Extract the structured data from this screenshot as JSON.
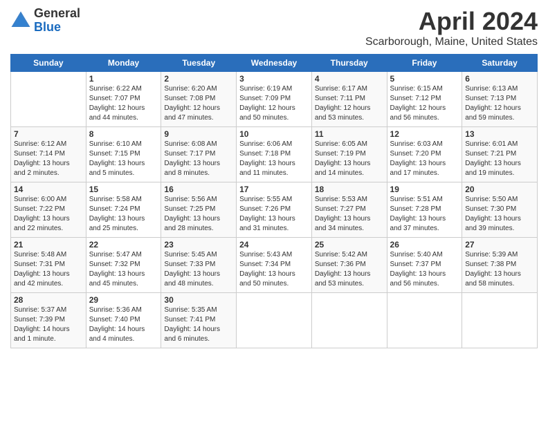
{
  "header": {
    "logo_general": "General",
    "logo_blue": "Blue",
    "month": "April 2024",
    "location": "Scarborough, Maine, United States"
  },
  "weekdays": [
    "Sunday",
    "Monday",
    "Tuesday",
    "Wednesday",
    "Thursday",
    "Friday",
    "Saturday"
  ],
  "weeks": [
    [
      {
        "day": "",
        "sunrise": "",
        "sunset": "",
        "daylight": ""
      },
      {
        "day": "1",
        "sunrise": "Sunrise: 6:22 AM",
        "sunset": "Sunset: 7:07 PM",
        "daylight": "Daylight: 12 hours and 44 minutes."
      },
      {
        "day": "2",
        "sunrise": "Sunrise: 6:20 AM",
        "sunset": "Sunset: 7:08 PM",
        "daylight": "Daylight: 12 hours and 47 minutes."
      },
      {
        "day": "3",
        "sunrise": "Sunrise: 6:19 AM",
        "sunset": "Sunset: 7:09 PM",
        "daylight": "Daylight: 12 hours and 50 minutes."
      },
      {
        "day": "4",
        "sunrise": "Sunrise: 6:17 AM",
        "sunset": "Sunset: 7:11 PM",
        "daylight": "Daylight: 12 hours and 53 minutes."
      },
      {
        "day": "5",
        "sunrise": "Sunrise: 6:15 AM",
        "sunset": "Sunset: 7:12 PM",
        "daylight": "Daylight: 12 hours and 56 minutes."
      },
      {
        "day": "6",
        "sunrise": "Sunrise: 6:13 AM",
        "sunset": "Sunset: 7:13 PM",
        "daylight": "Daylight: 12 hours and 59 minutes."
      }
    ],
    [
      {
        "day": "7",
        "sunrise": "Sunrise: 6:12 AM",
        "sunset": "Sunset: 7:14 PM",
        "daylight": "Daylight: 13 hours and 2 minutes."
      },
      {
        "day": "8",
        "sunrise": "Sunrise: 6:10 AM",
        "sunset": "Sunset: 7:15 PM",
        "daylight": "Daylight: 13 hours and 5 minutes."
      },
      {
        "day": "9",
        "sunrise": "Sunrise: 6:08 AM",
        "sunset": "Sunset: 7:17 PM",
        "daylight": "Daylight: 13 hours and 8 minutes."
      },
      {
        "day": "10",
        "sunrise": "Sunrise: 6:06 AM",
        "sunset": "Sunset: 7:18 PM",
        "daylight": "Daylight: 13 hours and 11 minutes."
      },
      {
        "day": "11",
        "sunrise": "Sunrise: 6:05 AM",
        "sunset": "Sunset: 7:19 PM",
        "daylight": "Daylight: 13 hours and 14 minutes."
      },
      {
        "day": "12",
        "sunrise": "Sunrise: 6:03 AM",
        "sunset": "Sunset: 7:20 PM",
        "daylight": "Daylight: 13 hours and 17 minutes."
      },
      {
        "day": "13",
        "sunrise": "Sunrise: 6:01 AM",
        "sunset": "Sunset: 7:21 PM",
        "daylight": "Daylight: 13 hours and 19 minutes."
      }
    ],
    [
      {
        "day": "14",
        "sunrise": "Sunrise: 6:00 AM",
        "sunset": "Sunset: 7:22 PM",
        "daylight": "Daylight: 13 hours and 22 minutes."
      },
      {
        "day": "15",
        "sunrise": "Sunrise: 5:58 AM",
        "sunset": "Sunset: 7:24 PM",
        "daylight": "Daylight: 13 hours and 25 minutes."
      },
      {
        "day": "16",
        "sunrise": "Sunrise: 5:56 AM",
        "sunset": "Sunset: 7:25 PM",
        "daylight": "Daylight: 13 hours and 28 minutes."
      },
      {
        "day": "17",
        "sunrise": "Sunrise: 5:55 AM",
        "sunset": "Sunset: 7:26 PM",
        "daylight": "Daylight: 13 hours and 31 minutes."
      },
      {
        "day": "18",
        "sunrise": "Sunrise: 5:53 AM",
        "sunset": "Sunset: 7:27 PM",
        "daylight": "Daylight: 13 hours and 34 minutes."
      },
      {
        "day": "19",
        "sunrise": "Sunrise: 5:51 AM",
        "sunset": "Sunset: 7:28 PM",
        "daylight": "Daylight: 13 hours and 37 minutes."
      },
      {
        "day": "20",
        "sunrise": "Sunrise: 5:50 AM",
        "sunset": "Sunset: 7:30 PM",
        "daylight": "Daylight: 13 hours and 39 minutes."
      }
    ],
    [
      {
        "day": "21",
        "sunrise": "Sunrise: 5:48 AM",
        "sunset": "Sunset: 7:31 PM",
        "daylight": "Daylight: 13 hours and 42 minutes."
      },
      {
        "day": "22",
        "sunrise": "Sunrise: 5:47 AM",
        "sunset": "Sunset: 7:32 PM",
        "daylight": "Daylight: 13 hours and 45 minutes."
      },
      {
        "day": "23",
        "sunrise": "Sunrise: 5:45 AM",
        "sunset": "Sunset: 7:33 PM",
        "daylight": "Daylight: 13 hours and 48 minutes."
      },
      {
        "day": "24",
        "sunrise": "Sunrise: 5:43 AM",
        "sunset": "Sunset: 7:34 PM",
        "daylight": "Daylight: 13 hours and 50 minutes."
      },
      {
        "day": "25",
        "sunrise": "Sunrise: 5:42 AM",
        "sunset": "Sunset: 7:36 PM",
        "daylight": "Daylight: 13 hours and 53 minutes."
      },
      {
        "day": "26",
        "sunrise": "Sunrise: 5:40 AM",
        "sunset": "Sunset: 7:37 PM",
        "daylight": "Daylight: 13 hours and 56 minutes."
      },
      {
        "day": "27",
        "sunrise": "Sunrise: 5:39 AM",
        "sunset": "Sunset: 7:38 PM",
        "daylight": "Daylight: 13 hours and 58 minutes."
      }
    ],
    [
      {
        "day": "28",
        "sunrise": "Sunrise: 5:37 AM",
        "sunset": "Sunset: 7:39 PM",
        "daylight": "Daylight: 14 hours and 1 minute."
      },
      {
        "day": "29",
        "sunrise": "Sunrise: 5:36 AM",
        "sunset": "Sunset: 7:40 PM",
        "daylight": "Daylight: 14 hours and 4 minutes."
      },
      {
        "day": "30",
        "sunrise": "Sunrise: 5:35 AM",
        "sunset": "Sunset: 7:41 PM",
        "daylight": "Daylight: 14 hours and 6 minutes."
      },
      {
        "day": "",
        "sunrise": "",
        "sunset": "",
        "daylight": ""
      },
      {
        "day": "",
        "sunrise": "",
        "sunset": "",
        "daylight": ""
      },
      {
        "day": "",
        "sunrise": "",
        "sunset": "",
        "daylight": ""
      },
      {
        "day": "",
        "sunrise": "",
        "sunset": "",
        "daylight": ""
      }
    ]
  ]
}
